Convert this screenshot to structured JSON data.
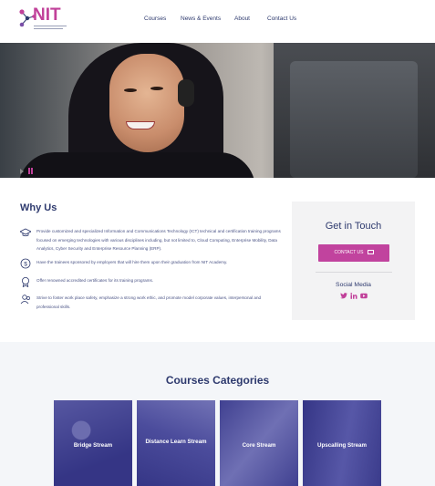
{
  "header": {
    "logo_text": "NIT",
    "nav": [
      "Courses",
      "News & Events",
      "About",
      "Contact Us"
    ]
  },
  "hero": {
    "slider_controls": [
      "play-icon",
      "pause-icon"
    ]
  },
  "why_us": {
    "title": "Why Us",
    "items": [
      {
        "icon": "graduation-cap-icon",
        "text": "Provide customized and specialized Information and Communications Technology (ICT) technical and certification training programs focused on emerging technologies with various disciplines including, but not limited to, Cloud Computing, Enterprise Mobility, Data Analytics, Cyber Security and Enterprise Resource Planning (ERP)."
      },
      {
        "icon": "dollar-icon",
        "text": "Have the trainees sponsored by employers that will hire them upon their graduation from NIT Academy."
      },
      {
        "icon": "certificate-icon",
        "text": "Offer renowned accredited certificates for its training programs."
      },
      {
        "icon": "users-icon",
        "text": "Strive to foster work place safety, emphasize a strong work ethic, and promote model corporate values, interpersonal and professional skills."
      }
    ]
  },
  "touch": {
    "title": "Get in Touch",
    "contact_label": "CONTACT US",
    "social_title": "Social Media",
    "social": [
      "twitter-icon",
      "linkedin-icon",
      "youtube-icon"
    ]
  },
  "courses": {
    "title": "Courses Categories",
    "cards": [
      {
        "label": "Bridge Stream"
      },
      {
        "label": "Distance Learn Stream"
      },
      {
        "label": "Core Stream"
      },
      {
        "label": "Upscalling Stream"
      }
    ]
  },
  "colors": {
    "brand_navy": "#2e3a6e",
    "brand_magenta": "#c1419a",
    "card_overlay": "#3b3c9a"
  }
}
